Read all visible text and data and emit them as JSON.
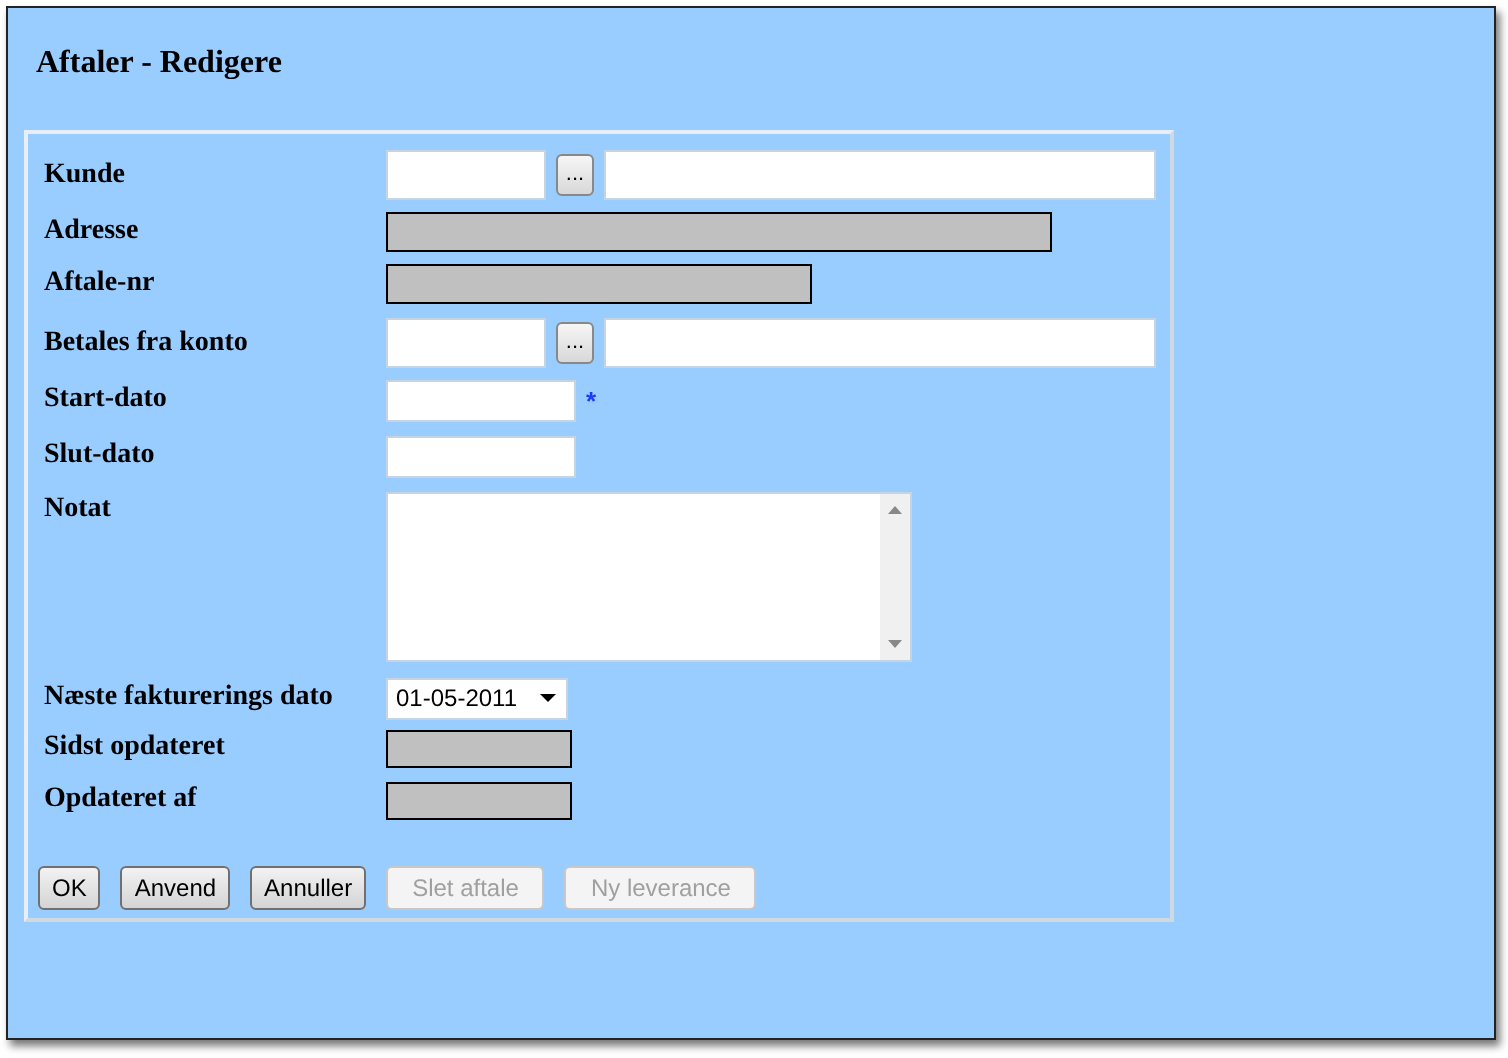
{
  "window": {
    "title": "Aftaler - Redigere"
  },
  "fields": [
    {
      "kind": "lookup",
      "label": "Kunde",
      "button": "..."
    },
    {
      "kind": "address",
      "label": "Adresse"
    },
    {
      "kind": "number",
      "label": "Aftale-nr"
    },
    {
      "kind": "lookup",
      "label": "Betales fra konto",
      "button": "..."
    },
    {
      "kind": "date",
      "label": "Start-dato",
      "marker": "*"
    },
    {
      "kind": "date",
      "label": "Slut-dato"
    },
    {
      "kind": "note",
      "label": "Notat"
    },
    {
      "kind": "select",
      "label": "Næste fakturerings dato",
      "value": "01-05-2011"
    },
    {
      "kind": "stamp",
      "label": "Sidst opdateret"
    },
    {
      "kind": "stamp",
      "label": "Opdateret af"
    }
  ],
  "buttons": [
    {
      "label": "OK",
      "disabled": false
    },
    {
      "label": "Anvend",
      "disabled": false
    },
    {
      "label": "Annuller",
      "disabled": false
    },
    {
      "label": "Slet aftale",
      "disabled": true
    },
    {
      "label": "Ny leverance",
      "disabled": true
    }
  ]
}
